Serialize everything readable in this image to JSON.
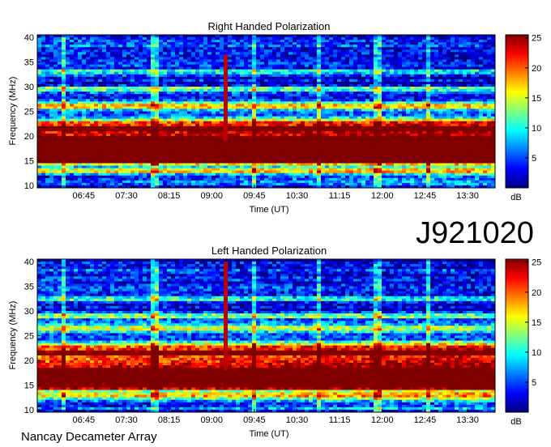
{
  "observation_id": "J921020",
  "footer_label": "Nancay Decameter Array",
  "chart_data": [
    {
      "type": "heatmap",
      "title": "Right Handed Polarization",
      "xlabel": "Time (UT)",
      "ylabel": "Frequency (MHz)",
      "x_ticks": [
        "06:45",
        "07:30",
        "08:15",
        "09:00",
        "09:45",
        "10:30",
        "11:15",
        "12:00",
        "12:45",
        "13:30"
      ],
      "y_ticks": [
        10,
        15,
        20,
        25,
        30,
        35,
        40
      ],
      "xlim_minutes_ut": [
        356,
        839
      ],
      "ylim": [
        9.5,
        40.5
      ],
      "colorbar": {
        "label": "dB",
        "ticks": [
          5,
          10,
          15,
          20,
          25
        ],
        "range": [
          0,
          25.5
        ],
        "colormap": "jet"
      },
      "bright_bands": [
        {
          "freq": 16.5,
          "width": 1.6,
          "level": 24
        },
        {
          "freq": 18.0,
          "width": 1.5,
          "level": 22
        },
        {
          "freq": 19.5,
          "width": 1.3,
          "level": 16
        },
        {
          "freq": 21.3,
          "width": 0.7,
          "level": 23
        },
        {
          "freq": 22.6,
          "width": 0.8,
          "level": 16
        },
        {
          "freq": 14.8,
          "width": 0.6,
          "level": 17
        },
        {
          "freq": 13.0,
          "width": 0.7,
          "level": 12
        },
        {
          "freq": 26.2,
          "width": 0.8,
          "level": 14
        },
        {
          "freq": 29.5,
          "width": 0.6,
          "level": 9
        },
        {
          "freq": 33.0,
          "width": 0.5,
          "level": 8
        }
      ],
      "burst": {
        "time": "09:14",
        "freq_range": [
          19,
          36.5
        ],
        "level": 24
      }
    },
    {
      "type": "heatmap",
      "title": "Left Handed Polarization",
      "xlabel": "Time (UT)",
      "ylabel": "Frequency (MHz)",
      "x_ticks": [
        "06:45",
        "07:30",
        "08:15",
        "09:00",
        "09:45",
        "10:30",
        "11:15",
        "12:00",
        "12:45",
        "13:30"
      ],
      "y_ticks": [
        10,
        15,
        20,
        25,
        30,
        35,
        40
      ],
      "xlim_minutes_ut": [
        356,
        839
      ],
      "ylim": [
        9.5,
        40.5
      ],
      "colorbar": {
        "label": "dB",
        "ticks": [
          5,
          10,
          15,
          20,
          25
        ],
        "range": [
          0,
          25.5
        ],
        "colormap": "jet"
      },
      "bright_bands": [
        {
          "freq": 16.0,
          "width": 1.5,
          "level": 23
        },
        {
          "freq": 17.7,
          "width": 1.4,
          "level": 22
        },
        {
          "freq": 19.8,
          "width": 1.2,
          "level": 15
        },
        {
          "freq": 21.5,
          "width": 0.7,
          "level": 21
        },
        {
          "freq": 22.8,
          "width": 0.8,
          "level": 14
        },
        {
          "freq": 14.5,
          "width": 0.6,
          "level": 16
        },
        {
          "freq": 12.8,
          "width": 0.7,
          "level": 13
        },
        {
          "freq": 26.5,
          "width": 0.9,
          "level": 13
        },
        {
          "freq": 29.0,
          "width": 0.7,
          "level": 9
        },
        {
          "freq": 32.5,
          "width": 0.6,
          "level": 8
        }
      ],
      "burst": {
        "time": "09:14",
        "freq_range": [
          18,
          40
        ],
        "level": 24
      }
    }
  ]
}
